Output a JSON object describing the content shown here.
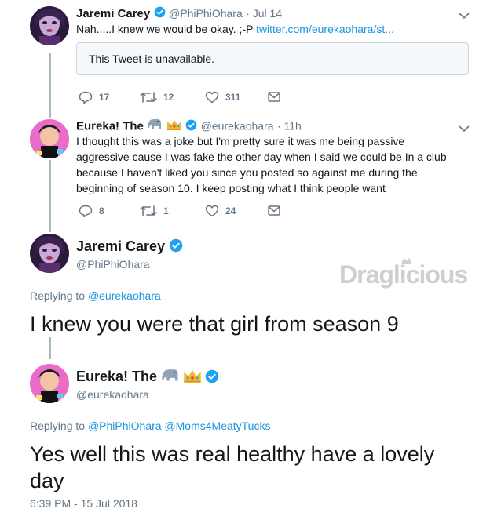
{
  "tweet1": {
    "name": "Jaremi Carey",
    "handle": "@PhiPhiOhara",
    "date": "· Jul 14",
    "text": "Nah.....I knew we would be okay. ;-P ",
    "link": "twitter.com/eurekaohara/st...",
    "quote_unavailable": "This Tweet is unavailable.",
    "replies": "17",
    "retweets": "12",
    "likes": "311"
  },
  "tweet2": {
    "name": "Eureka! The",
    "handle": "@eurekaohara",
    "date": "· 11h",
    "text": "I thought this was a joke but I'm pretty sure it was me being passive aggressive cause I was fake the other day when I said we could be In a club because I haven't liked you since you posted so against me during the beginning of season 10. I keep posting what I think people want",
    "replies": "8",
    "retweets": "1",
    "likes": "24"
  },
  "tweet3": {
    "name": "Jaremi Carey",
    "handle": "@PhiPhiOhara",
    "replying_prefix": "Replying to ",
    "replying_to": "@eurekaohara",
    "text": "I knew you were that girl from season 9"
  },
  "tweet4": {
    "name": "Eureka! The",
    "handle": "@eurekaohara",
    "replying_prefix": "Replying to ",
    "replying_to_1": "@PhiPhiOhara",
    "replying_to_2": "@Moms4MeatyTucks",
    "text": "Yes well this was real healthy have a lovely day",
    "timestamp": "6:39 PM - 15 Jul 2018"
  },
  "watermark": "Draglicious",
  "colors": {
    "link": "#1b95e0",
    "verified": "#1da1f2",
    "secondary_text": "#657786",
    "thread_line": "#aab8c2"
  },
  "icons": [
    "reply-icon",
    "retweet-icon",
    "like-icon",
    "dm-icon",
    "verified-icon",
    "chevron-down-icon",
    "elephant-emoji",
    "crown-emoji"
  ]
}
